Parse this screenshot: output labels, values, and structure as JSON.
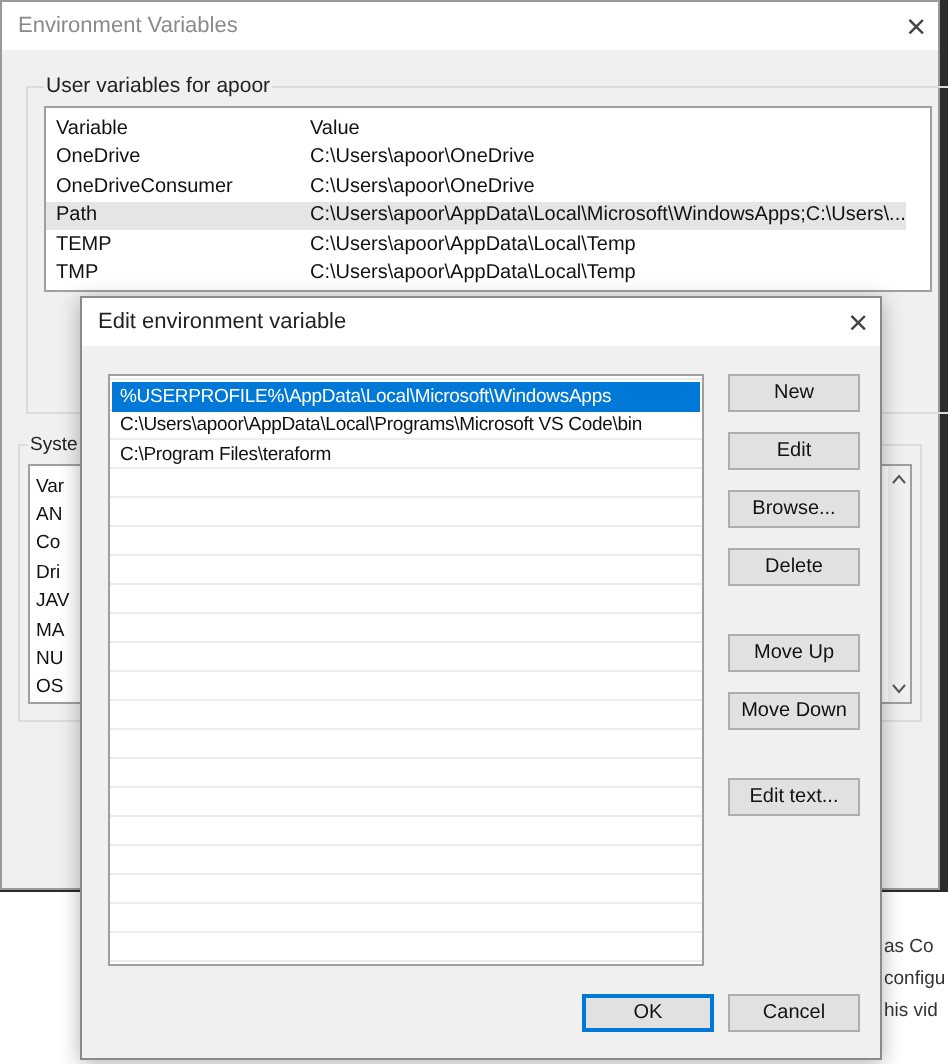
{
  "background_window": {
    "title": "Environment Variables",
    "close": "×",
    "user_variables": {
      "group_label": "User variables for apoor",
      "columns": [
        "Variable",
        "Value"
      ],
      "rows": [
        {
          "variable": "OneDrive",
          "value": "C:\\Users\\apoor\\OneDrive",
          "selected": false
        },
        {
          "variable": "OneDriveConsumer",
          "value": "C:\\Users\\apoor\\OneDrive",
          "selected": false
        },
        {
          "variable": "Path",
          "value": "C:\\Users\\apoor\\AppData\\Local\\Microsoft\\WindowsApps;C:\\Users\\...",
          "selected": true
        },
        {
          "variable": "TEMP",
          "value": "C:\\Users\\apoor\\AppData\\Local\\Temp",
          "selected": false
        },
        {
          "variable": "TMP",
          "value": "C:\\Users\\apoor\\AppData\\Local\\Temp",
          "selected": false
        }
      ]
    },
    "system_variables": {
      "group_label": "Syste",
      "column": "Var",
      "rows": [
        "AN",
        "Co",
        "Dri",
        "JAV",
        "MA",
        "NU",
        "OS"
      ]
    }
  },
  "page_text": [
    "as Co",
    "configu",
    "his vid"
  ],
  "dialog": {
    "title": "Edit environment variable",
    "close": "×",
    "paths": [
      {
        "text": "%USERPROFILE%\\AppData\\Local\\Microsoft\\WindowsApps",
        "selected": true
      },
      {
        "text": "C:\\Users\\apoor\\AppData\\Local\\Programs\\Microsoft VS Code\\bin",
        "selected": false
      },
      {
        "text": "C:\\Program Files\\teraform",
        "selected": false
      }
    ],
    "button_groups": [
      [
        "New",
        "Edit",
        "Browse...",
        "Delete"
      ],
      [
        "Move Up",
        "Move Down"
      ],
      [
        "Edit text..."
      ]
    ],
    "footer_buttons": [
      {
        "label": "OK",
        "default": true
      },
      {
        "label": "Cancel",
        "default": false
      }
    ]
  }
}
